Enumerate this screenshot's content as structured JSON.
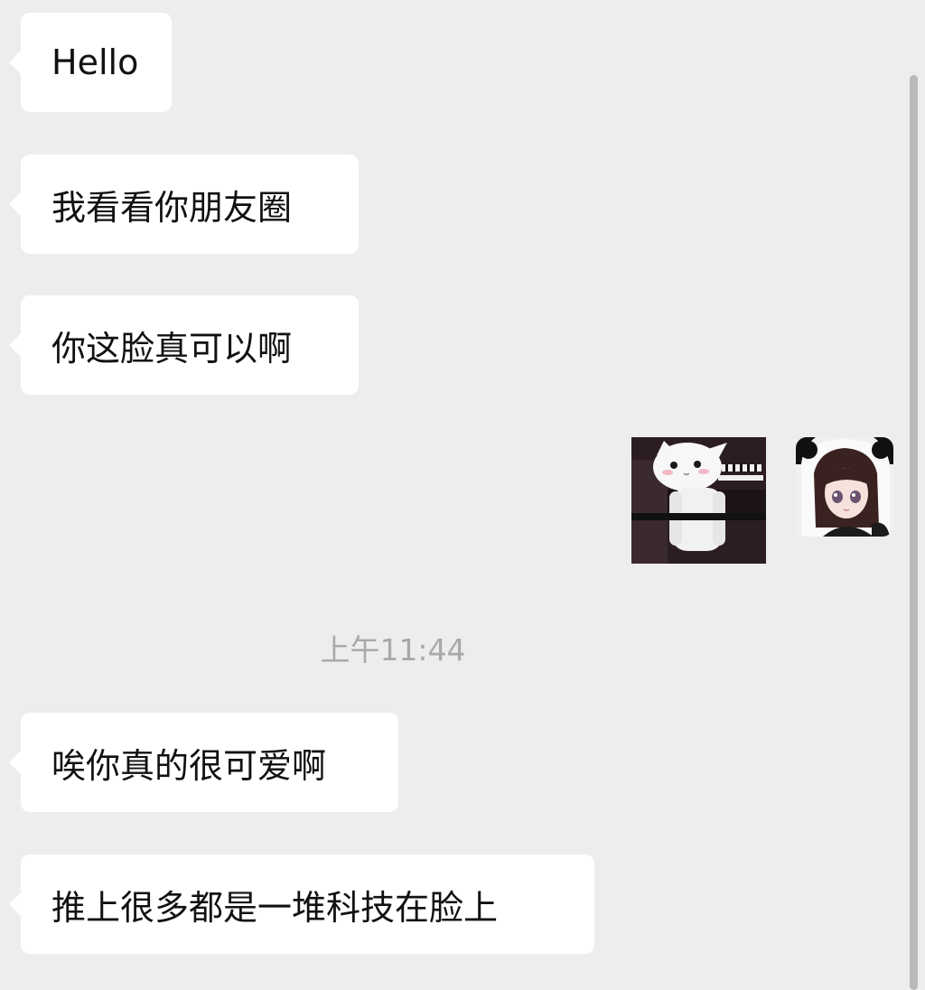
{
  "messages": [
    {
      "text": "Hello"
    },
    {
      "text": "我看看你朋友圈"
    },
    {
      "text": "你这脸真可以啊"
    },
    {
      "text": "唉你真的很可爱啊"
    },
    {
      "text": "推上很多都是一堆科技在脸上"
    }
  ],
  "timestamp": "上午11:44",
  "sticker": {
    "icon": "cat-sticker-image"
  },
  "avatar": {
    "icon": "anime-girl-avatar"
  },
  "colors": {
    "background": "#ededed",
    "bubble": "#ffffff",
    "text": "#111111",
    "timestamp": "#a9a9a9"
  }
}
